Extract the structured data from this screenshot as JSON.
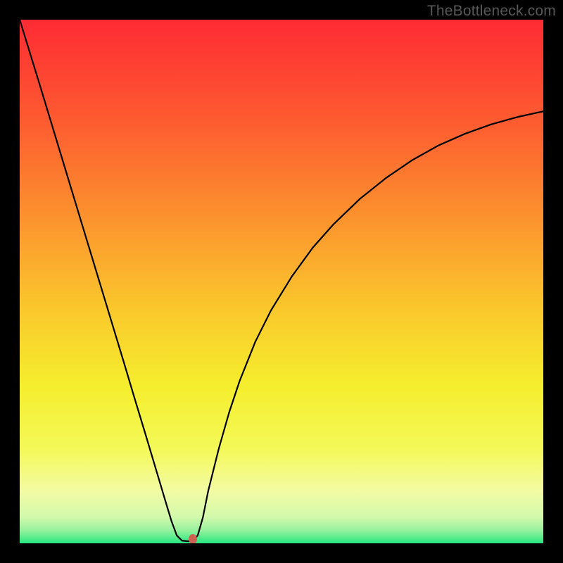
{
  "watermark": "TheBottleneck.com",
  "colors": {
    "frame": "#000000",
    "gradient_stops": [
      {
        "pos": 0.0,
        "color": "#fe2b34"
      },
      {
        "pos": 0.2,
        "color": "#fd5d30"
      },
      {
        "pos": 0.4,
        "color": "#fc992e"
      },
      {
        "pos": 0.55,
        "color": "#fac72c"
      },
      {
        "pos": 0.7,
        "color": "#f5ee2d"
      },
      {
        "pos": 0.82,
        "color": "#f4f958"
      },
      {
        "pos": 0.9,
        "color": "#f3fba4"
      },
      {
        "pos": 0.95,
        "color": "#d2f9ab"
      },
      {
        "pos": 0.975,
        "color": "#97f19e"
      },
      {
        "pos": 1.0,
        "color": "#27e780"
      }
    ],
    "curve": "#000000",
    "marker": "#cd6152"
  },
  "chart_data": {
    "type": "line",
    "title": "",
    "xlabel": "",
    "ylabel": "",
    "xlim": [
      0,
      100
    ],
    "ylim": [
      0,
      100
    ],
    "grid": false,
    "legend": false,
    "series": [
      {
        "name": "bottleneck-curve",
        "x": [
          0,
          2,
          4,
          6,
          8,
          10,
          12,
          14,
          16,
          18,
          20,
          22,
          24,
          26,
          28,
          29,
          30,
          31,
          32,
          33,
          34,
          35,
          36,
          38,
          40,
          42,
          45,
          48,
          52,
          56,
          60,
          65,
          70,
          75,
          80,
          85,
          90,
          95,
          100
        ],
        "y": [
          100,
          93.5,
          87.0,
          80.4,
          73.8,
          67.2,
          60.6,
          54.0,
          47.4,
          40.8,
          34.2,
          27.5,
          20.9,
          14.2,
          7.5,
          4.2,
          1.5,
          0.5,
          0.4,
          0.4,
          1.5,
          5.0,
          10.0,
          18.0,
          25.0,
          31.0,
          38.5,
          44.5,
          51.0,
          56.5,
          61.0,
          65.8,
          69.8,
          73.2,
          76.0,
          78.2,
          80.0,
          81.4,
          82.5
        ]
      }
    ],
    "marker": {
      "x": 33,
      "y": 0.8
    },
    "plateau": {
      "x_start": 30.5,
      "x_end": 33.5,
      "y": 0.4
    }
  }
}
